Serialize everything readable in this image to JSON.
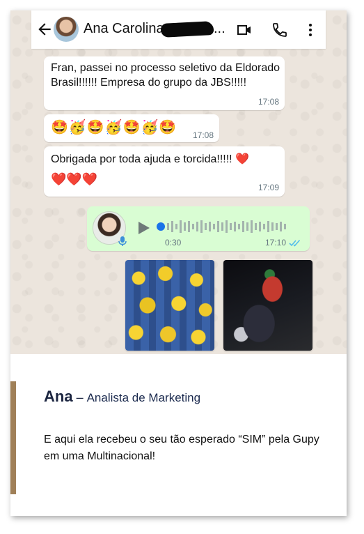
{
  "chat_header": {
    "contact_name": "Ana Carolina",
    "truncation": "..."
  },
  "messages": [
    {
      "text": "Fran, passei no processo seletivo da Eldorado Brasil!!!!!! Empresa do grupo da JBS!!!!!",
      "time": "17:08"
    },
    {
      "text": "🤩🥳🤩🥳🤩🥳🤩",
      "time": "17:08"
    },
    {
      "text": "Obrigada por toda ajuda e torcida!!!!! ❤️",
      "text2": "❤️❤️❤️",
      "time": "17:09"
    }
  ],
  "voice_message": {
    "duration": "0:30",
    "time": "17:10",
    "status": "read",
    "status_color": "#53bdeb"
  },
  "colors": {
    "outgoing_bubble": "#d9fdd3",
    "chat_background": "#ece5dd",
    "accent_bar": "#a08058",
    "heading_text": "#1b2540"
  },
  "testimonial": {
    "name": "Ana",
    "separator": " – ",
    "role": "Analista de Marketing",
    "text": "E aqui ela recebeu o seu tão esperado “SIM” pela Gupy em uma Multinacional!"
  }
}
